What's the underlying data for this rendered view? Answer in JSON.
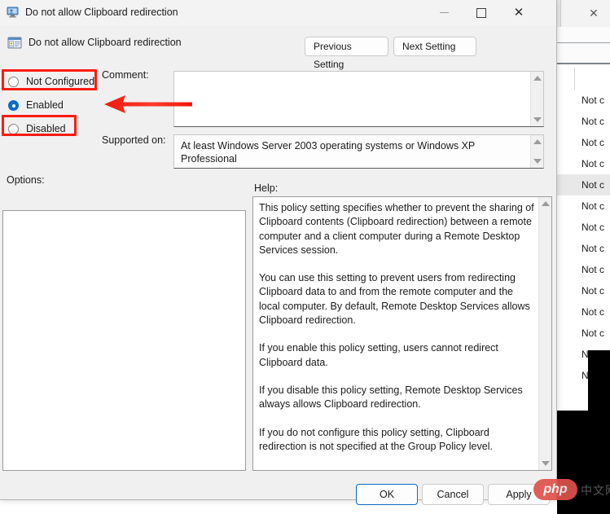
{
  "dialog": {
    "title": "Do not allow Clipboard redirection",
    "title_icon": "monitor-policy-icon",
    "header_title": "Do not allow Clipboard redirection",
    "header_icon": "policy-setting-icon",
    "window_buttons": {
      "minimize": "minimize-icon",
      "maximize": "maximize-icon",
      "close": "close-icon"
    },
    "nav": {
      "previous": "Previous Setting",
      "next": "Next Setting"
    },
    "state_options": [
      {
        "label": "Not Configured",
        "checked": false
      },
      {
        "label": "Enabled",
        "checked": true
      },
      {
        "label": "Disabled",
        "checked": false
      }
    ],
    "comment": {
      "label": "Comment:",
      "value": "",
      "placeholder": ""
    },
    "supported": {
      "label": "Supported on:",
      "value": "At least Windows Server 2003 operating systems or Windows XP Professional"
    },
    "options": {
      "label": "Options:",
      "value": ""
    },
    "help": {
      "label": "Help:",
      "paragraphs": [
        "This policy setting specifies whether to prevent the sharing of Clipboard contents (Clipboard redirection) between a remote computer and a client computer during a Remote Desktop Services session.",
        "You can use this setting to prevent users from redirecting Clipboard data to and from the remote computer and the local computer. By default, Remote Desktop Services allows Clipboard redirection.",
        "If you enable this policy setting, users cannot redirect Clipboard data.",
        "If you disable this policy setting, Remote Desktop Services always allows Clipboard redirection.",
        "If you do not configure this policy setting, Clipboard redirection is not specified at the Group Policy level."
      ]
    },
    "footer": {
      "ok": "OK",
      "cancel": "Cancel",
      "apply": "Apply"
    }
  },
  "background_window": {
    "close_label": "✕",
    "rows": [
      "Not c",
      "Not c",
      "Not c",
      "Not c",
      "Not c",
      "Not c",
      "Not c",
      "Not c",
      "Not c",
      "Not c",
      "Not c",
      "Not c",
      "Not c",
      "Not c"
    ],
    "selected_row_index": 4
  },
  "annotations": {
    "highlight_color": "#fd1c10",
    "arrow_color": "#fd1c10",
    "highlight_targets": [
      "Not Configured",
      "Disabled"
    ],
    "arrow_points_to": "Enabled"
  },
  "watermark": {
    "logo_text": "php",
    "site_text": "中文网"
  }
}
